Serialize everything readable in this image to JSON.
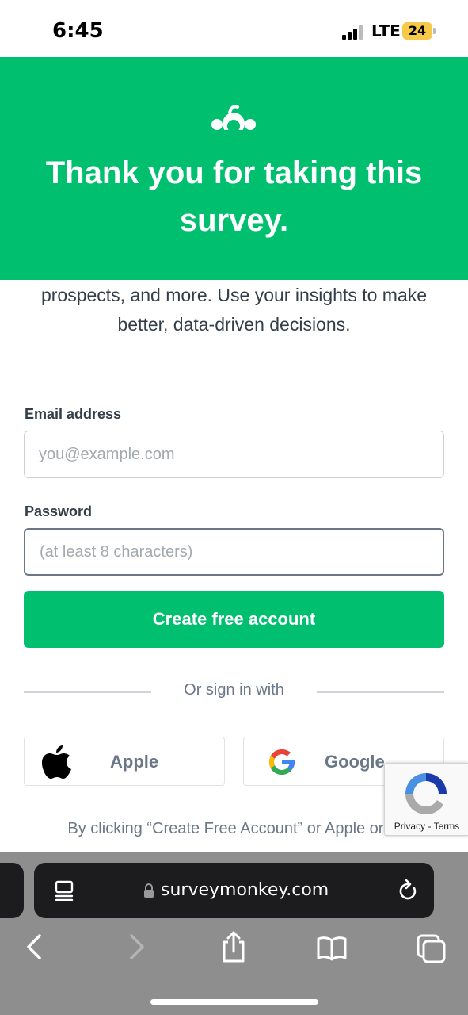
{
  "status_bar": {
    "time": "6:45",
    "network": "LTE",
    "battery": "24"
  },
  "hero": {
    "title": "Thank you for taking this survey.",
    "background": "#00bf6f"
  },
  "intro_text": "prospects, and more. Use your insights to make better, data-driven decisions.",
  "form": {
    "email_label": "Email address",
    "email_placeholder": "you@example.com",
    "password_label": "Password",
    "password_placeholder": "(at least 8 characters)",
    "submit_label": "Create free account"
  },
  "social": {
    "divider_text": "Or sign in with",
    "apple_label": "Apple",
    "google_label": "Google"
  },
  "recaptcha": {
    "privacy": "Privacy",
    "separator": " - ",
    "terms": "Terms"
  },
  "terms_text": "By clicking “Create Free Account” or Apple or G",
  "browser": {
    "url": "surveymonkey.com"
  },
  "colors": {
    "brand_green": "#00bf6f",
    "text_dark": "#333e48",
    "text_muted": "#6b7787"
  }
}
